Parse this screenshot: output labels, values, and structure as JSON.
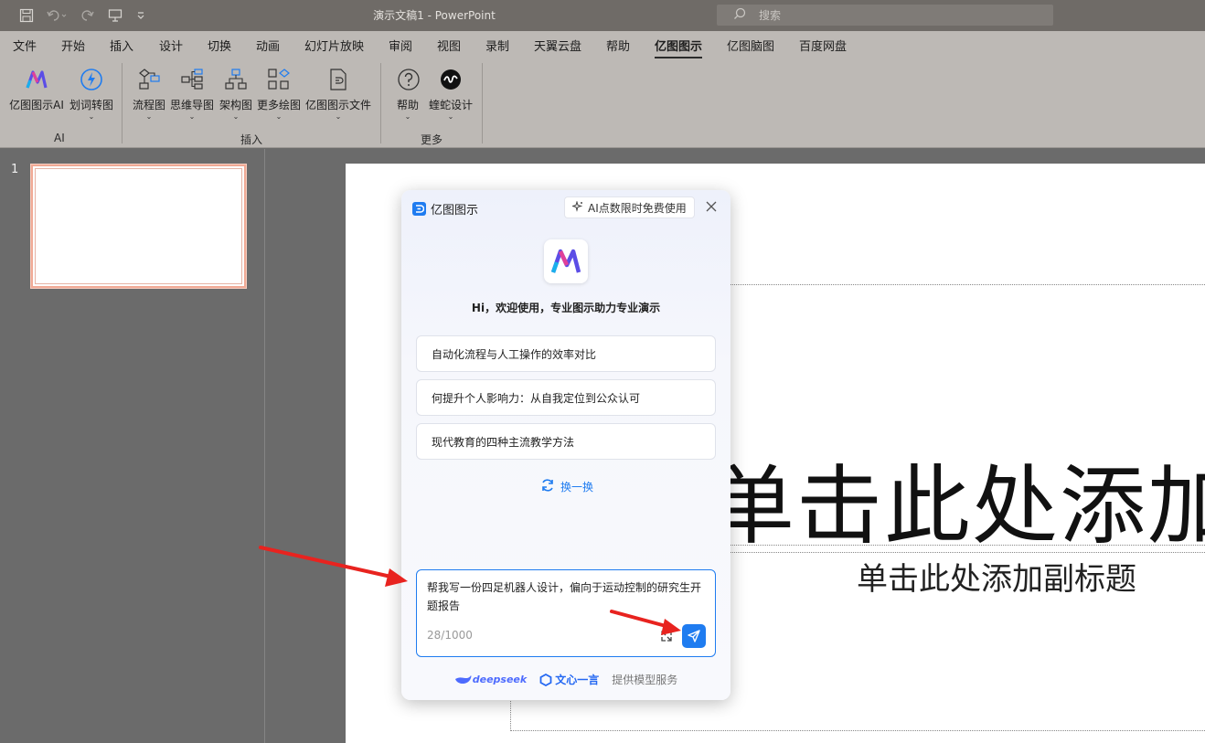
{
  "window": {
    "title": "演示文稿1  -  PowerPoint",
    "search_placeholder": "搜索"
  },
  "menu": {
    "tabs": [
      "文件",
      "开始",
      "插入",
      "设计",
      "切换",
      "动画",
      "幻灯片放映",
      "审阅",
      "视图",
      "录制",
      "天翼云盘",
      "帮助",
      "亿图图示",
      "亿图脑图",
      "百度网盘"
    ],
    "active": "亿图图示"
  },
  "ribbon": {
    "ai_group": {
      "label": "AI",
      "buttons": [
        "亿图图示AI",
        "划词转图"
      ]
    },
    "insert_group": {
      "label": "插入",
      "buttons": [
        "流程图",
        "思维导图",
        "架构图",
        "更多绘图",
        "亿图图示文件"
      ]
    },
    "more_group": {
      "label": "更多",
      "buttons": [
        "帮助",
        "蝰蛇设计"
      ]
    }
  },
  "thumbnails": {
    "number": "1"
  },
  "slide": {
    "title_placeholder": "单击此处添加标题",
    "subtitle_placeholder": "单击此处添加副标题"
  },
  "panel": {
    "brand": "亿图图示",
    "badge": "AI点数限时免费使用",
    "welcome": "Hi，欢迎使用，专业图示助力专业演示",
    "suggestions": [
      "自动化流程与人工操作的效率对比",
      "何提升个人影响力：从自我定位到公众认可",
      "现代教育的四种主流教学方法"
    ],
    "refresh_label": "换一换",
    "input_text": "帮我写一份四足机器人设计，偏向于运动控制的研究生开题报告",
    "char_count": "28/1000",
    "footer": {
      "deepseek": "deepseek",
      "wenxin": "文心一言",
      "provider": "提供模型服务"
    }
  },
  "colors": {
    "accent": "#1f7cf0",
    "arrow": "#e8231f",
    "ribbon_bg": "#bdb9b5",
    "title_bg": "#6f6b67"
  }
}
